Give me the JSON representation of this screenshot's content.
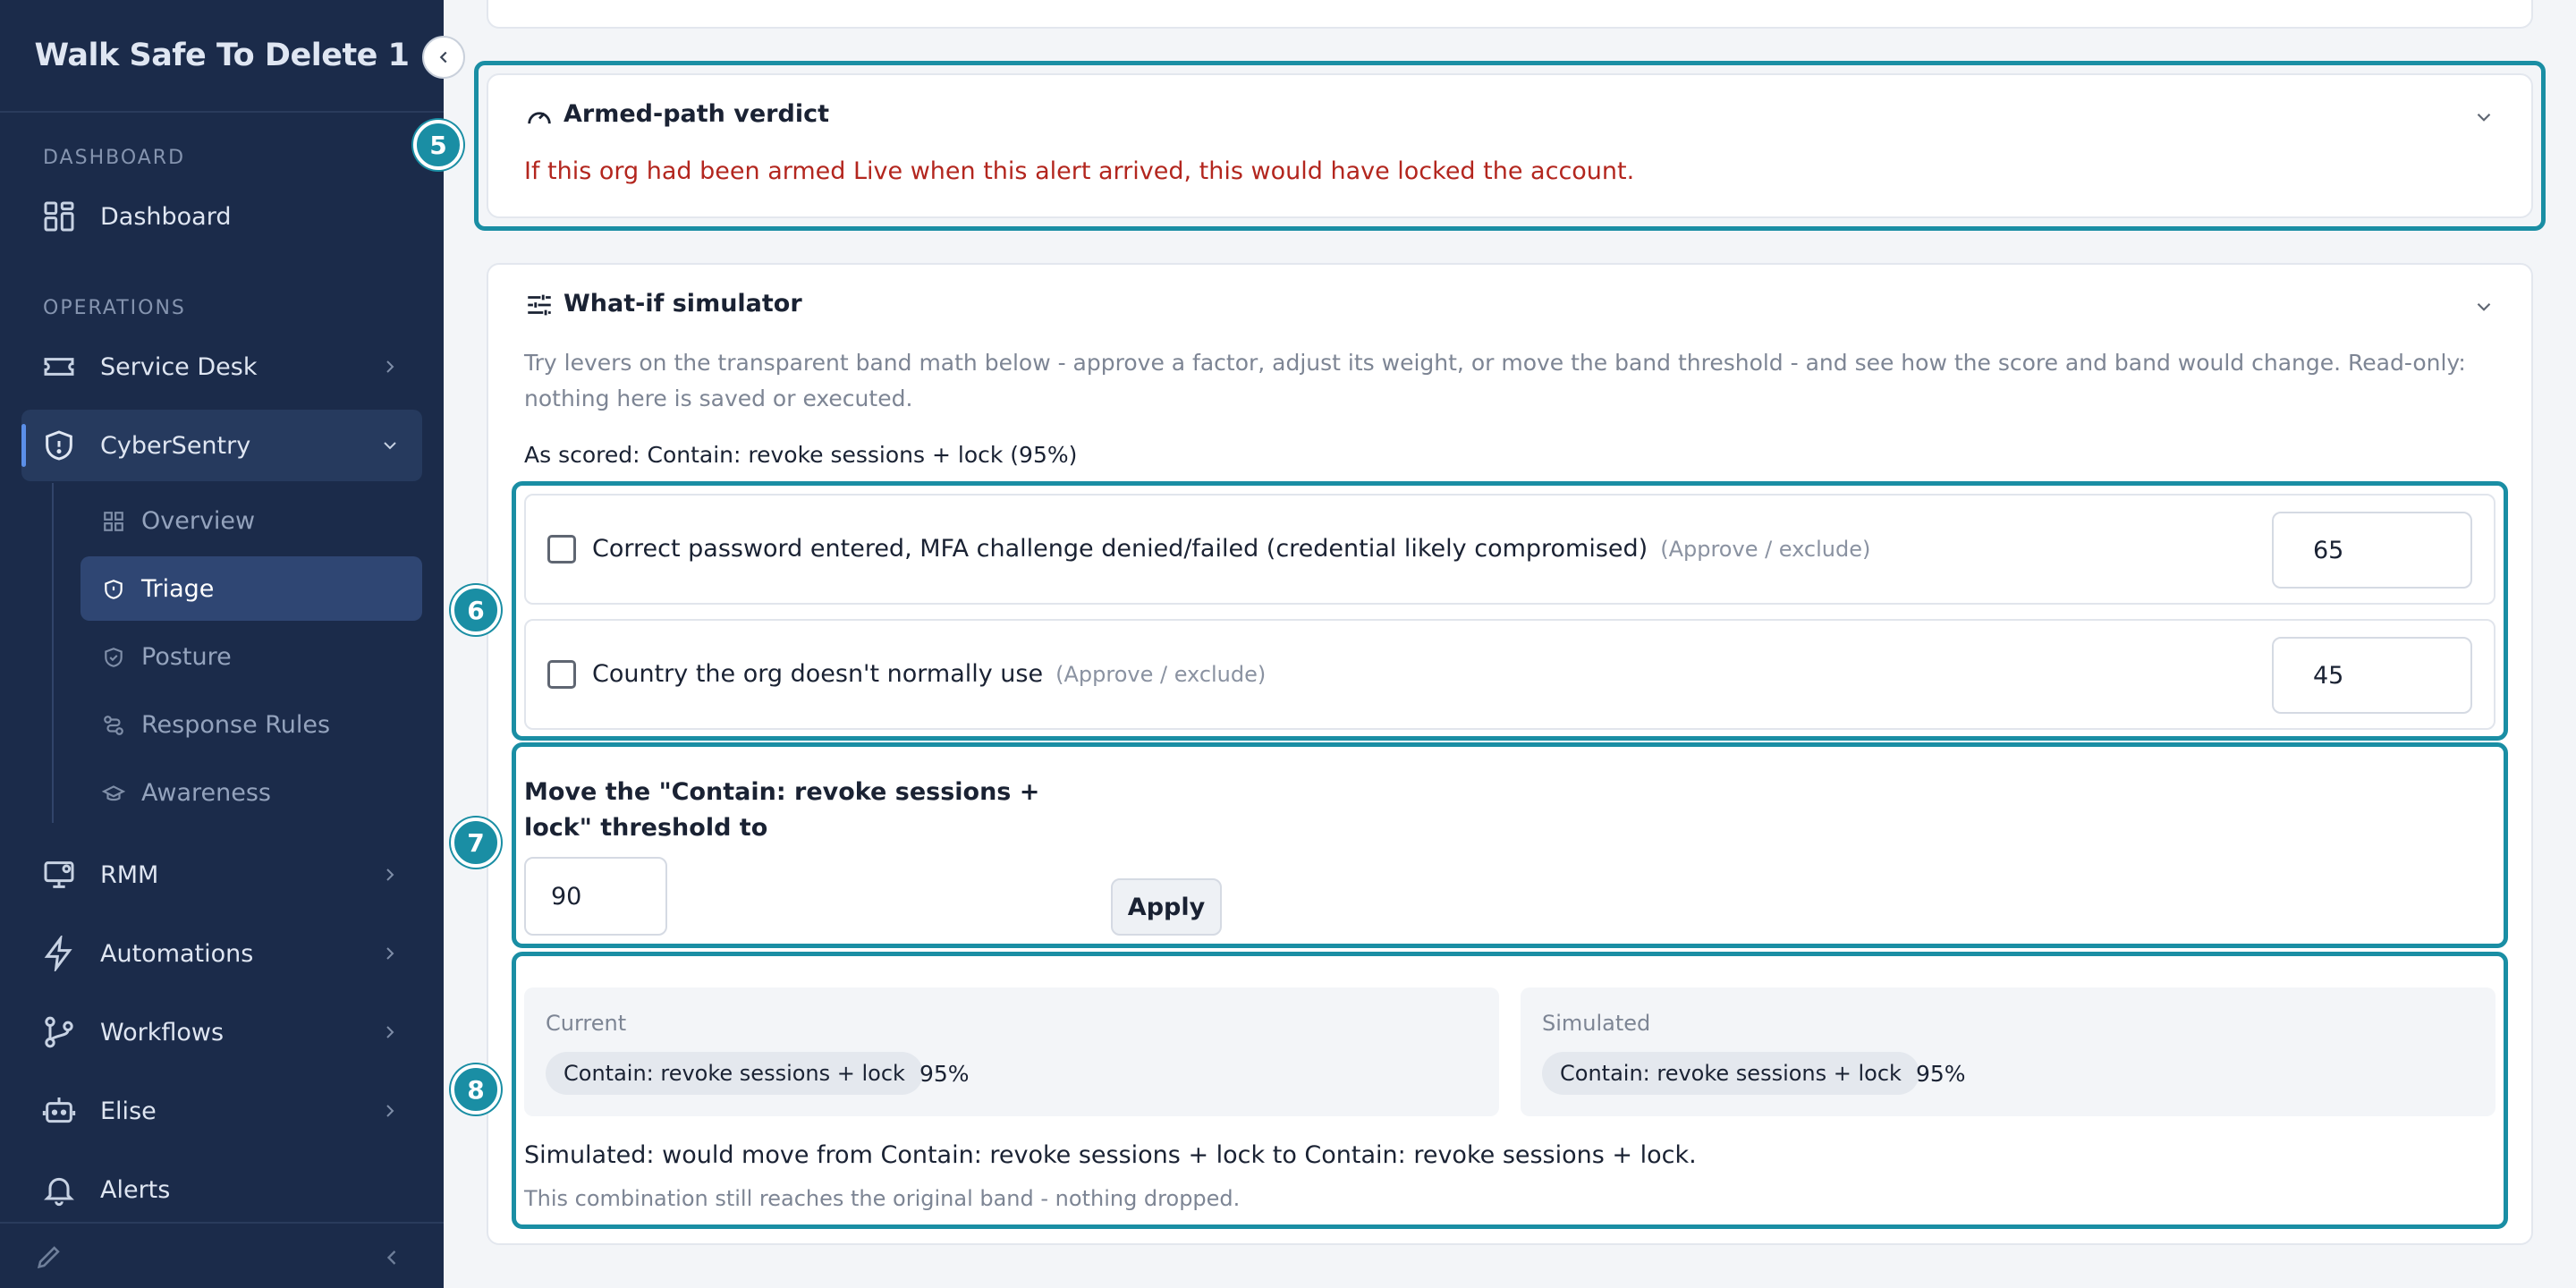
{
  "sidebar": {
    "brand": "Walk Safe To Delete 1",
    "sections": {
      "dashboard": "DASHBOARD",
      "operations": "OPERATIONS"
    },
    "items": {
      "dashboard": "Dashboard",
      "service_desk": "Service Desk",
      "cybersentry": "CyberSentry",
      "rmm": "RMM",
      "automations": "Automations",
      "workflows": "Workflows",
      "elise": "Elise",
      "alerts": "Alerts"
    },
    "subitems": {
      "overview": "Overview",
      "triage": "Triage",
      "posture": "Posture",
      "response_rules": "Response Rules",
      "awareness": "Awareness"
    }
  },
  "badges": {
    "verdict": "5",
    "factors": "6",
    "threshold": "7",
    "results": "8"
  },
  "verdict": {
    "title": "Armed-path verdict",
    "text": "If this org had been armed Live when this alert arrived, this would have locked the account."
  },
  "simulator": {
    "title": "What-if simulator",
    "description": "Try levers on the transparent band math below - approve a factor, adjust its weight, or move the band threshold - and see how the score and band would change. Read-only: nothing here is saved or executed.",
    "as_scored": "As scored: Contain: revoke sessions + lock (95%)",
    "factors": [
      {
        "label": "Correct password entered, MFA challenge denied/failed (credential likely compromised)",
        "note": "(Approve / exclude)",
        "weight": "65"
      },
      {
        "label": "Country the org doesn't normally use",
        "note": "(Approve / exclude)",
        "weight": "45"
      }
    ],
    "threshold_label": "Move the \"Contain: revoke sessions + lock\" threshold to",
    "threshold_value": "90",
    "apply_label": "Apply",
    "current": {
      "label": "Current",
      "band": "Contain: revoke sessions + lock",
      "pct": "95%"
    },
    "simulated": {
      "label": "Simulated",
      "band": "Contain: revoke sessions + lock",
      "pct": "95%"
    },
    "summary": "Simulated: would move from Contain: revoke sessions + lock to Contain: revoke sessions + lock.",
    "summary_note": "This combination still reaches the original band - nothing dropped."
  },
  "colors": {
    "sidebar": "#1b2b4a",
    "accent": "#1a8ea4",
    "danger": "#b3261e"
  }
}
